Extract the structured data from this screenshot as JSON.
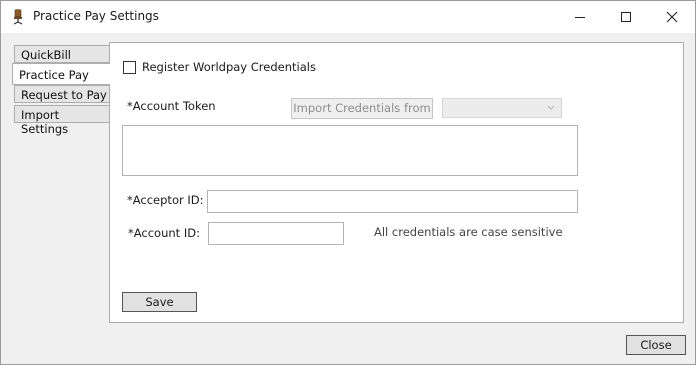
{
  "window": {
    "title": "Practice Pay Settings",
    "icon": "chair-icon",
    "controls": [
      "minimize-icon",
      "maximize-icon",
      "close-icon"
    ]
  },
  "tabs": [
    {
      "label": "QuickBill",
      "active": false
    },
    {
      "label": "Practice Pay",
      "active": true
    },
    {
      "label": "Request to Pay",
      "active": false
    },
    {
      "label": "Import Settings",
      "active": false
    }
  ],
  "practice_pay": {
    "register_checkbox": {
      "label": "Register Worldpay Credentials",
      "checked": false
    },
    "account_token_label": "*Account Token",
    "import_button_label": "Import Credentials from",
    "import_source": {
      "selected": ""
    },
    "account_token_value": "",
    "acceptor_id_label": "*Acceptor ID:",
    "acceptor_id_value": "",
    "account_id_label": "*Account ID:",
    "account_id_value": "",
    "case_note": "All credentials are case sensitive",
    "save_label": "Save"
  },
  "footer": {
    "close_label": "Close"
  }
}
